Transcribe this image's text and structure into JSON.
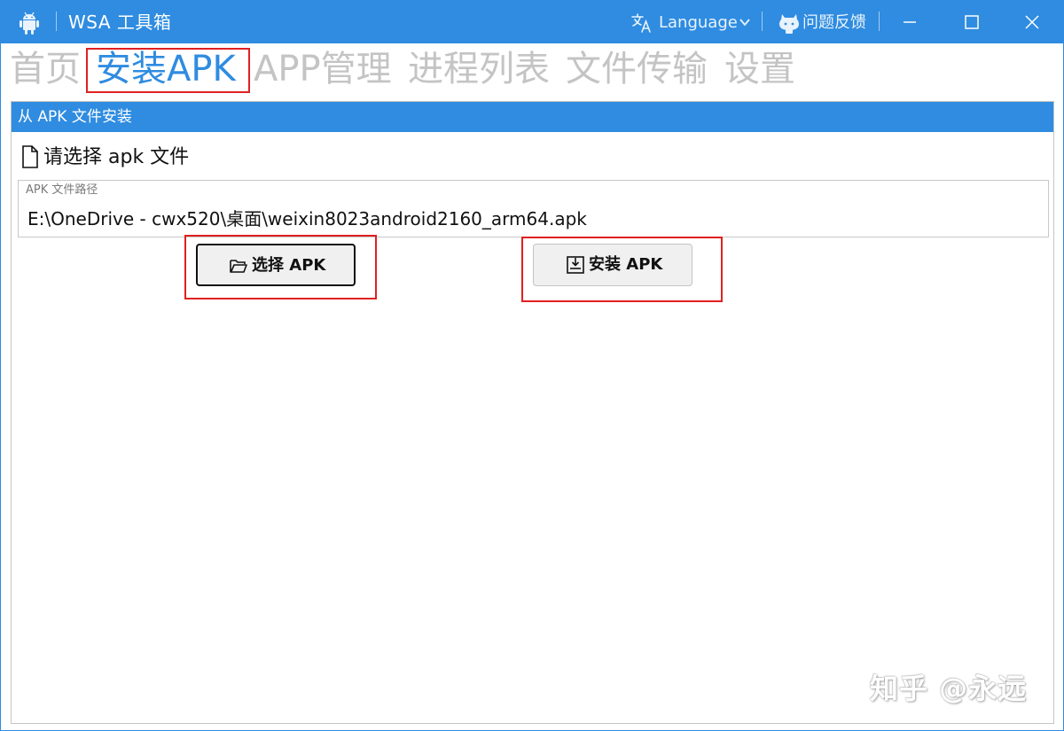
{
  "window": {
    "title": "WSA 工具箱",
    "language_label": "Language",
    "feedback_label": "问题反馈"
  },
  "nav": {
    "items": [
      {
        "label": "首页",
        "active": false
      },
      {
        "label": "安装APK",
        "active": true
      },
      {
        "label": "APP管理",
        "active": false
      },
      {
        "label": "进程列表",
        "active": false
      },
      {
        "label": "文件传输",
        "active": false
      },
      {
        "label": "设置",
        "active": false
      }
    ]
  },
  "install_panel": {
    "header": "从 APK 文件安装",
    "prompt": "请选择 apk 文件",
    "path_caption": "APK 文件路径",
    "path_value": "E:\\OneDrive - cwx520\\桌面\\weixin8023android2160_arm64.apk",
    "select_button": "选择 APK",
    "install_button": "安装 APK"
  },
  "watermark": "知乎 @永远",
  "colors": {
    "accent": "#2f8ce0",
    "nav_inactive": "#c4c4c4",
    "highlight_box": "#e02020"
  },
  "icons": [
    "android-icon",
    "translate-icon",
    "chevron-down-icon",
    "github-icon",
    "minimize-icon",
    "maximize-icon",
    "close-icon",
    "file-icon",
    "folder-open-icon",
    "install-download-icon"
  ]
}
